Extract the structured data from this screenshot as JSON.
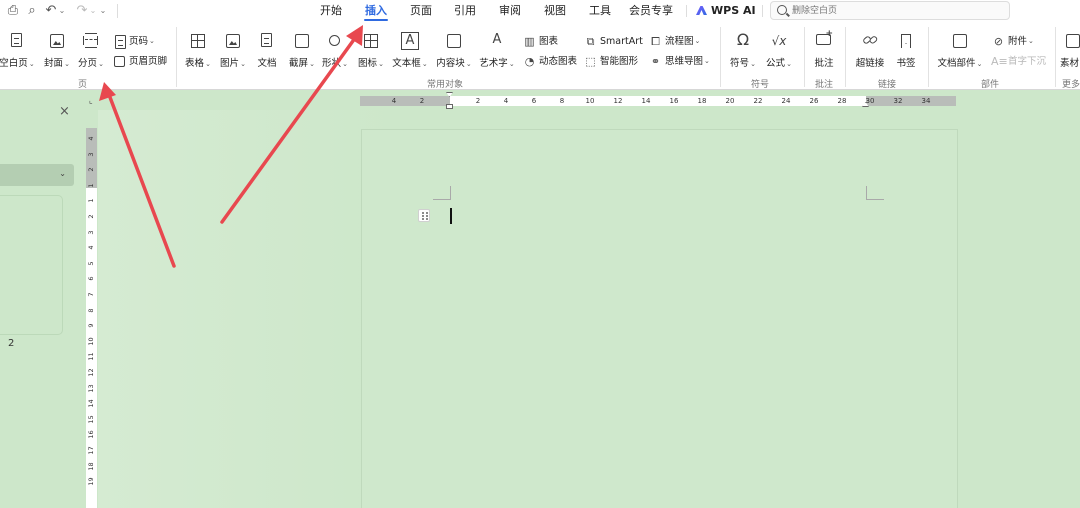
{
  "quick_access": {
    "undo_caret": "⌄",
    "redo_caret": "⌄",
    "more": "⌄"
  },
  "menu": {
    "tabs": [
      "开始",
      "插入",
      "页面",
      "引用",
      "审阅",
      "视图",
      "工具",
      "会员专享",
      "WPS AI"
    ],
    "active_tab": "插入",
    "search_placeholder": "删除空白页"
  },
  "ribbon": {
    "page_group": {
      "label": "页",
      "blank_page": "空白页",
      "cover": "封面",
      "page_break": "分页",
      "page_number": "页码",
      "header_footer": "页眉页脚"
    },
    "common_objects_group": {
      "label": "常用对象",
      "table": "表格",
      "picture": "图片",
      "document": "文档",
      "screenshot": "截屏",
      "shape": "形状",
      "icon": "图标",
      "textbox": "文本框",
      "content_block": "内容块",
      "art_text": "艺术字",
      "chart": "图表",
      "dynamic_chart": "动态图表",
      "smartart": "SmartArt",
      "smart_shape": "智能图形",
      "flowchart": "流程图",
      "mindmap": "思维导图"
    },
    "symbols_group": {
      "label": "符号",
      "symbol": "符号",
      "formula": "公式"
    },
    "comment_group": {
      "label": "批注",
      "comment": "批注"
    },
    "link_group": {
      "label": "链接",
      "hyperlink": "超链接",
      "bookmark": "书签"
    },
    "parts_group": {
      "label": "部件",
      "doc_parts": "文档部件",
      "attachment": "附件",
      "drop_cap": "首字下沉"
    },
    "more_group": {
      "label": "更多",
      "material": "素材"
    }
  },
  "hruler_ticks": [
    "4",
    "2",
    "2",
    "4",
    "6",
    "8",
    "10",
    "12",
    "14",
    "16",
    "18",
    "20",
    "22",
    "24",
    "26",
    "28",
    "30",
    "32",
    "34"
  ],
  "vruler_ticks": [
    "4",
    "3",
    "2",
    "1",
    "1",
    "2",
    "3",
    "4",
    "5",
    "6",
    "7",
    "8",
    "9",
    "10",
    "11",
    "12",
    "13",
    "14",
    "15",
    "16",
    "17",
    "18",
    "19"
  ],
  "nav_pane": {
    "close": "×",
    "page_number": "2"
  },
  "colors": {
    "accent": "#2f6ae0",
    "document_bg": "#cde7ca",
    "arrow": "#e8484f"
  }
}
